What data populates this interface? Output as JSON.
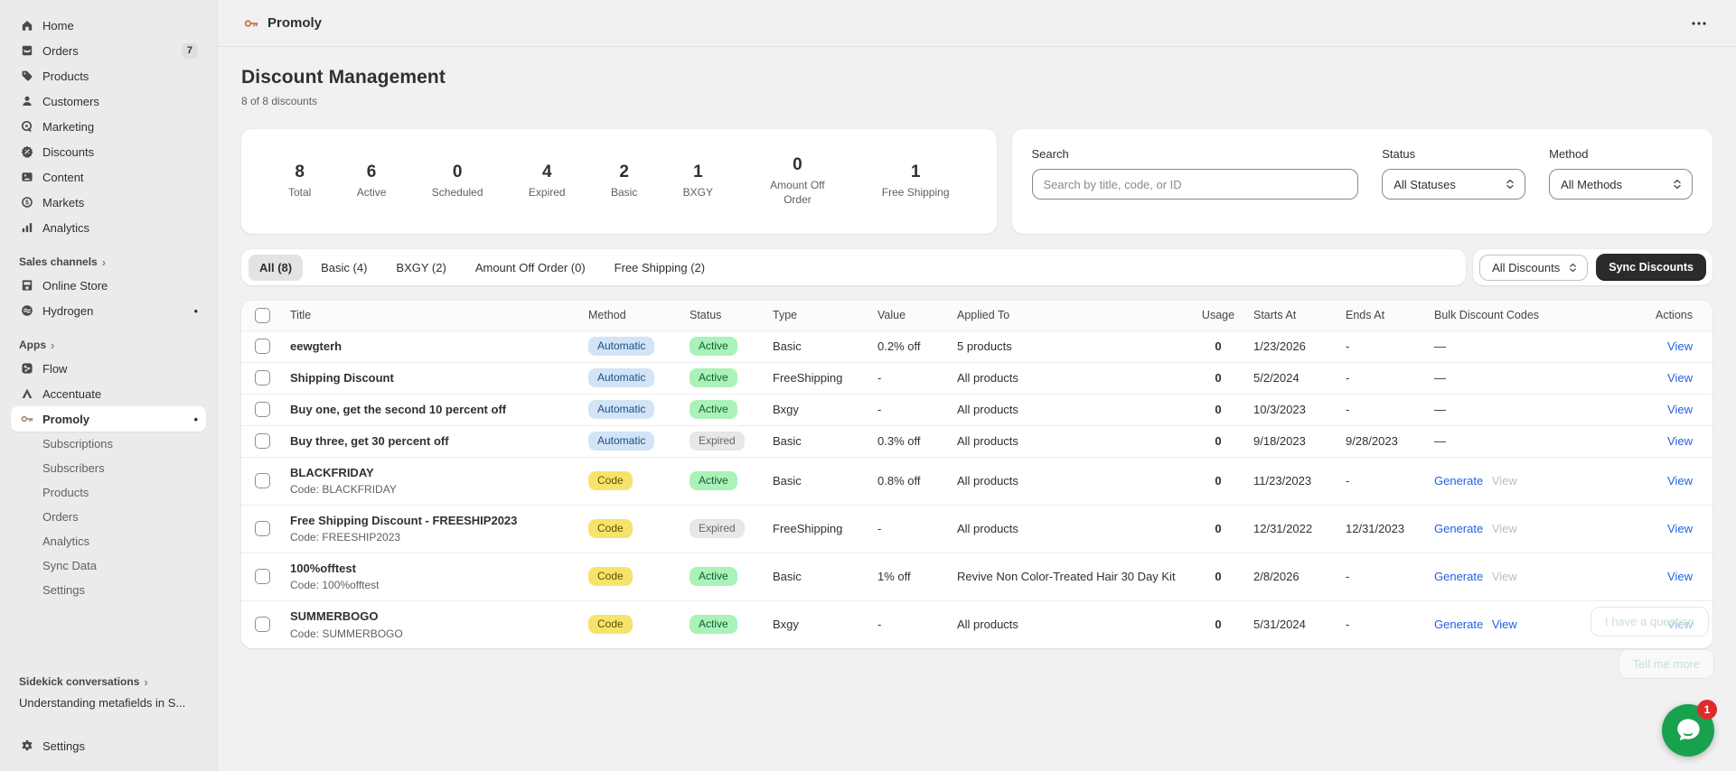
{
  "colors": {
    "sidebar_bg": "#ebebeb",
    "content_bg": "#f1f1f1",
    "accent_blue": "#2360e0",
    "pill_automatic_bg": "#d2e4f6",
    "pill_code_bg": "#f7e36c",
    "pill_active_bg": "#aaf2b8",
    "pill_expired_bg": "#e7e7e7",
    "sync_button_bg": "#2b2b2b",
    "promoly_orange": "#c7764f",
    "chat_green": "#19a24e",
    "chat_badge_red": "#df2b2b"
  },
  "sidebar": {
    "main": [
      {
        "label": "Home",
        "icon": "home-icon"
      },
      {
        "label": "Orders",
        "icon": "orders-icon",
        "badge": "7"
      },
      {
        "label": "Products",
        "icon": "products-icon"
      },
      {
        "label": "Customers",
        "icon": "customers-icon"
      },
      {
        "label": "Marketing",
        "icon": "marketing-icon"
      },
      {
        "label": "Discounts",
        "icon": "discounts-icon"
      },
      {
        "label": "Content",
        "icon": "content-icon"
      },
      {
        "label": "Markets",
        "icon": "markets-icon"
      },
      {
        "label": "Analytics",
        "icon": "analytics-icon"
      }
    ],
    "sales_channels_label": "Sales channels",
    "channels": [
      {
        "label": "Online Store",
        "icon": "online-store-icon"
      },
      {
        "label": "Hydrogen",
        "icon": "hydrogen-icon",
        "dot": "•"
      }
    ],
    "apps_label": "Apps",
    "apps": [
      {
        "label": "Flow",
        "icon": "flow-icon"
      },
      {
        "label": "Accentuate",
        "icon": "accentuate-icon"
      },
      {
        "label": "Promoly",
        "icon": "promoly-key-icon",
        "dot": "•"
      }
    ],
    "promoly_children": [
      "Subscriptions",
      "Subscribers",
      "Products",
      "Orders",
      "Analytics",
      "Sync Data",
      "Settings"
    ],
    "sidekick_label": "Sidekick conversations",
    "conversation": "Understanding metafields in S...",
    "settings_label": "Settings"
  },
  "header": {
    "app_title": "Promoly"
  },
  "page": {
    "title": "Discount Management",
    "subtitle": "8 of 8 discounts"
  },
  "stats": [
    {
      "value": "8",
      "label": "Total"
    },
    {
      "value": "6",
      "label": "Active"
    },
    {
      "value": "0",
      "label": "Scheduled"
    },
    {
      "value": "4",
      "label": "Expired"
    },
    {
      "value": "2",
      "label": "Basic"
    },
    {
      "value": "1",
      "label": "BXGY"
    },
    {
      "value": "0",
      "label": "Amount Off Order"
    },
    {
      "value": "1",
      "label": "Free Shipping"
    }
  ],
  "filters": {
    "search": {
      "label": "Search",
      "placeholder": "Search by title, code, or ID"
    },
    "status": {
      "label": "Status",
      "value": "All Statuses"
    },
    "method": {
      "label": "Method",
      "value": "All Methods"
    }
  },
  "tabs": [
    {
      "label": "All (8)",
      "active": true
    },
    {
      "label": "Basic (4)",
      "active": false
    },
    {
      "label": "BXGY (2)",
      "active": false
    },
    {
      "label": "Amount Off Order (0)",
      "active": false
    },
    {
      "label": "Free Shipping (2)",
      "active": false
    }
  ],
  "toolbar": {
    "discount_filter": "All Discounts",
    "sync_label": "Sync Discounts"
  },
  "table": {
    "columns": {
      "title": "Title",
      "method": "Method",
      "status": "Status",
      "type": "Type",
      "value": "Value",
      "applied_to": "Applied To",
      "usage": "Usage",
      "starts_at": "Starts At",
      "ends_at": "Ends At",
      "bulk": "Bulk Discount Codes",
      "actions": "Actions"
    },
    "rows": [
      {
        "title": "eewgterh",
        "method": "Automatic",
        "status": "Active",
        "type": "Basic",
        "value": "0.2% off",
        "applied_to": "5 products",
        "usage": "0",
        "starts_at": "1/23/2026",
        "ends_at": "-",
        "bulk": "—",
        "action": "View"
      },
      {
        "title": "Shipping Discount",
        "method": "Automatic",
        "status": "Active",
        "type": "FreeShipping",
        "value": "-",
        "applied_to": "All products",
        "usage": "0",
        "starts_at": "5/2/2024",
        "ends_at": "-",
        "bulk": "—",
        "action": "View"
      },
      {
        "title": "Buy one, get the second 10 percent off",
        "method": "Automatic",
        "status": "Active",
        "type": "Bxgy",
        "value": "-",
        "applied_to": "All products",
        "usage": "0",
        "starts_at": "10/3/2023",
        "ends_at": "-",
        "bulk": "—",
        "action": "View"
      },
      {
        "title": "Buy three, get 30 percent off",
        "method": "Automatic",
        "status": "Expired",
        "type": "Basic",
        "value": "0.3% off",
        "applied_to": "All products",
        "usage": "0",
        "starts_at": "9/18/2023",
        "ends_at": "9/28/2023",
        "bulk": "—",
        "action": "View"
      },
      {
        "title": "BLACKFRIDAY",
        "code": "Code: BLACKFRIDAY",
        "method": "Code",
        "status": "Active",
        "type": "Basic",
        "value": "0.8% off",
        "applied_to": "All products",
        "usage": "0",
        "starts_at": "11/23/2023",
        "ends_at": "-",
        "bulk_generate": "Generate",
        "bulk_view": "View",
        "action": "View"
      },
      {
        "title": "Free Shipping Discount - FREESHIP2023",
        "code": "Code: FREESHIP2023",
        "method": "Code",
        "status": "Expired",
        "type": "FreeShipping",
        "value": "-",
        "applied_to": "All products",
        "usage": "0",
        "starts_at": "12/31/2022",
        "ends_at": "12/31/2023",
        "bulk_generate": "Generate",
        "bulk_view": "View",
        "action": "View"
      },
      {
        "title": "100%offtest",
        "code": "Code: 100%offtest",
        "method": "Code",
        "status": "Active",
        "type": "Basic",
        "value": "1% off",
        "applied_to": "Revive Non Color-Treated Hair 30 Day Kit",
        "usage": "0",
        "starts_at": "2/8/2026",
        "ends_at": "-",
        "bulk_generate": "Generate",
        "bulk_view": "View",
        "action": "View"
      },
      {
        "title": "SUMMERBOGO",
        "code": "Code: SUMMERBOGO",
        "method": "Code",
        "status": "Active",
        "type": "Bxgy",
        "value": "-",
        "applied_to": "All products",
        "usage": "0",
        "starts_at": "5/31/2024",
        "ends_at": "-",
        "bulk_generate": "Generate",
        "bulk_view": "View",
        "action": "View"
      }
    ]
  },
  "chat": {
    "ghost_primary": "I have a question",
    "ghost_secondary": "Tell me more",
    "badge": "1"
  }
}
